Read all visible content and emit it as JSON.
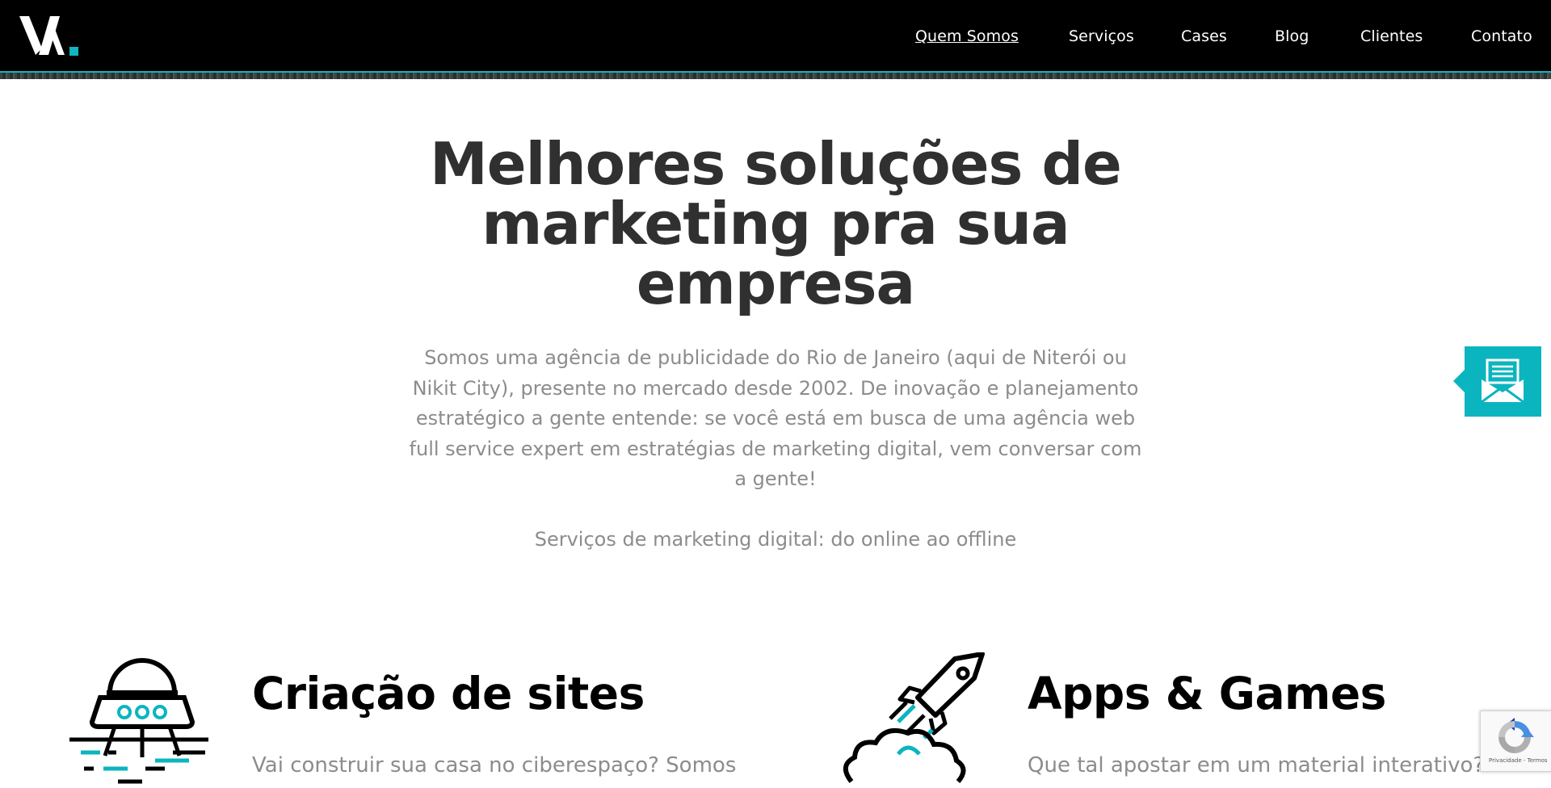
{
  "nav": {
    "logo_text": "VX.",
    "links": [
      {
        "label": "Quem Somos",
        "active": true
      },
      {
        "label": "Serviços",
        "active": false
      },
      {
        "label": "Cases",
        "active": false
      },
      {
        "label": "Blog",
        "active": false
      },
      {
        "label": "Clientes",
        "active": false
      },
      {
        "label": "Contato",
        "active": false
      }
    ]
  },
  "hero": {
    "title": "Melhores soluções de marketing pra sua empresa",
    "description": "Somos uma agência de publicidade do Rio de Janeiro (aqui de Niterói ou Nikit City), presente no mercado desde 2002. De inovação e planejamento estratégico a gente entende: se você está em busca de uma agência web full service expert em estratégias de marketing digital, vem conversar com a gente!",
    "subtitle": "Serviços de marketing digital: do online ao offline"
  },
  "services": [
    {
      "title": "Criação de sites",
      "text": "Vai construir sua casa no ciberespaço? Somos",
      "icon": "ufo-icon"
    },
    {
      "title": "Apps & Games",
      "text": "Que tal apostar em um material interativo?",
      "icon": "rocket-cloud-icon"
    }
  ],
  "contact_float": {
    "icon": "mail-icon"
  },
  "recaptcha": {
    "text": "Privacidade - Termos"
  },
  "colors": {
    "accent": "#0bb5bf",
    "nav_bg": "#000000",
    "heading": "#303030",
    "body_text": "#8c8c8c"
  }
}
